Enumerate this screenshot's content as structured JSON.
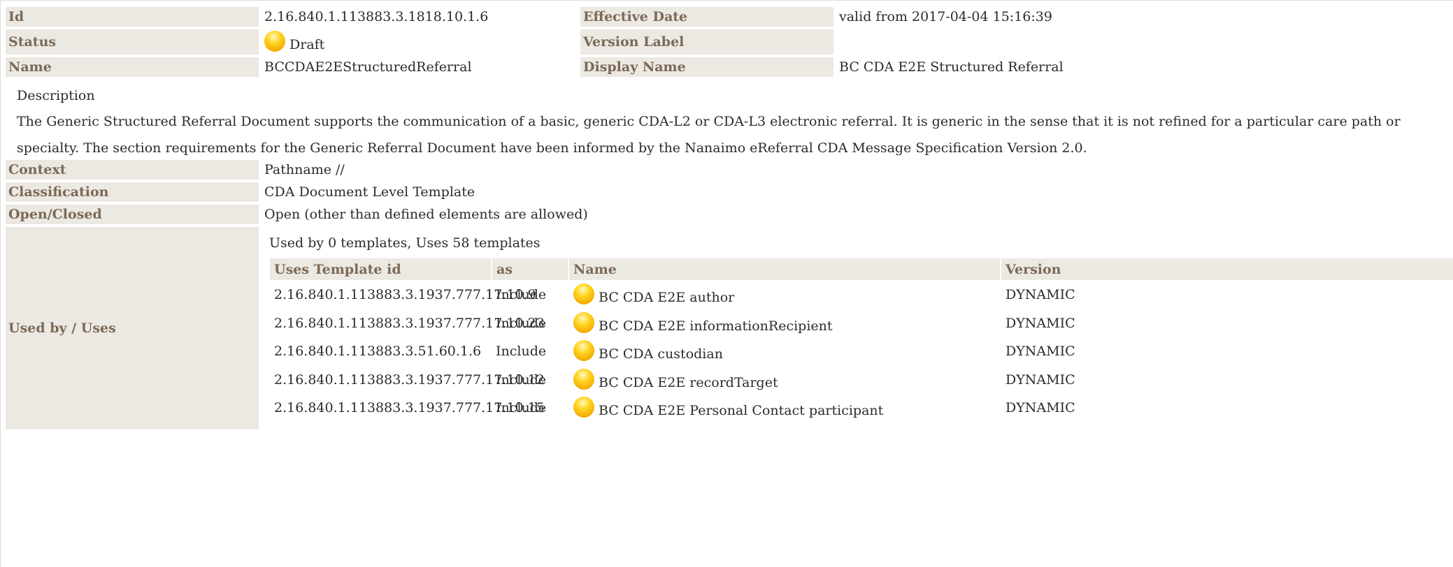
{
  "header": {
    "id_label": "Id",
    "id_value": "2.16.840.1.113883.3.1818.10.1.6",
    "effective_label": "Effective Date",
    "effective_value": "valid from 2017-04-04 15:16:39",
    "status_label": "Status",
    "status_value": "Draft",
    "version_label": "Version Label",
    "version_value": "",
    "name_label": "Name",
    "name_value": "BCCDAE2EStructuredReferral",
    "display_name_label": "Display Name",
    "display_name_value": "BC CDA E2E Structured Referral"
  },
  "description": {
    "heading": "Description",
    "text": "The Generic Structured Referral Document supports the communication of a basic, generic CDA-L2 or CDA-L3 electronic referral. It is generic in the sense that it is not refined for a particular care path or specialty.  The section requirements for the Generic Referral Document have been informed by the Nanaimo eReferral CDA Message Specification Version 2.0."
  },
  "details": {
    "context_label": "Context",
    "context_value": "Pathname //",
    "classification_label": "Classification",
    "classification_value": "CDA Document Level Template",
    "open_closed_label": "Open/Closed",
    "open_closed_value": "Open (other than defined elements are allowed)",
    "used_by_label": "Used by / Uses",
    "used_by_summary": "Used by 0 templates, Uses 58 templates"
  },
  "uses_table": {
    "headers": [
      "Uses Template id",
      "as",
      "Name",
      "Version"
    ],
    "rows": [
      {
        "id": "2.16.840.1.113883.3.1937.777.17.10.9",
        "as": "Include",
        "name": "BC CDA E2E author",
        "version": "DYNAMIC"
      },
      {
        "id": "2.16.840.1.113883.3.1937.777.17.10.23",
        "as": "Include",
        "name": "BC CDA E2E informationRecipient",
        "version": "DYNAMIC"
      },
      {
        "id": "2.16.840.1.113883.3.51.60.1.6",
        "as": "Include",
        "name": "BC CDA custodian",
        "version": "DYNAMIC"
      },
      {
        "id": "2.16.840.1.113883.3.1937.777.17.10.12",
        "as": "Include",
        "name": "BC CDA E2E recordTarget",
        "version": "DYNAMIC"
      },
      {
        "id": "2.16.840.1.113883.3.1937.777.17.10.15",
        "as": "Include",
        "name": "BC CDA E2E Personal Contact participant",
        "version": "DYNAMIC"
      }
    ]
  },
  "colors": {
    "label_bg": "#ece8e2",
    "label_text": "#7a6a58",
    "status_dot": "#ffd520"
  },
  "icons": {
    "status": "draft-status-dot-icon"
  }
}
